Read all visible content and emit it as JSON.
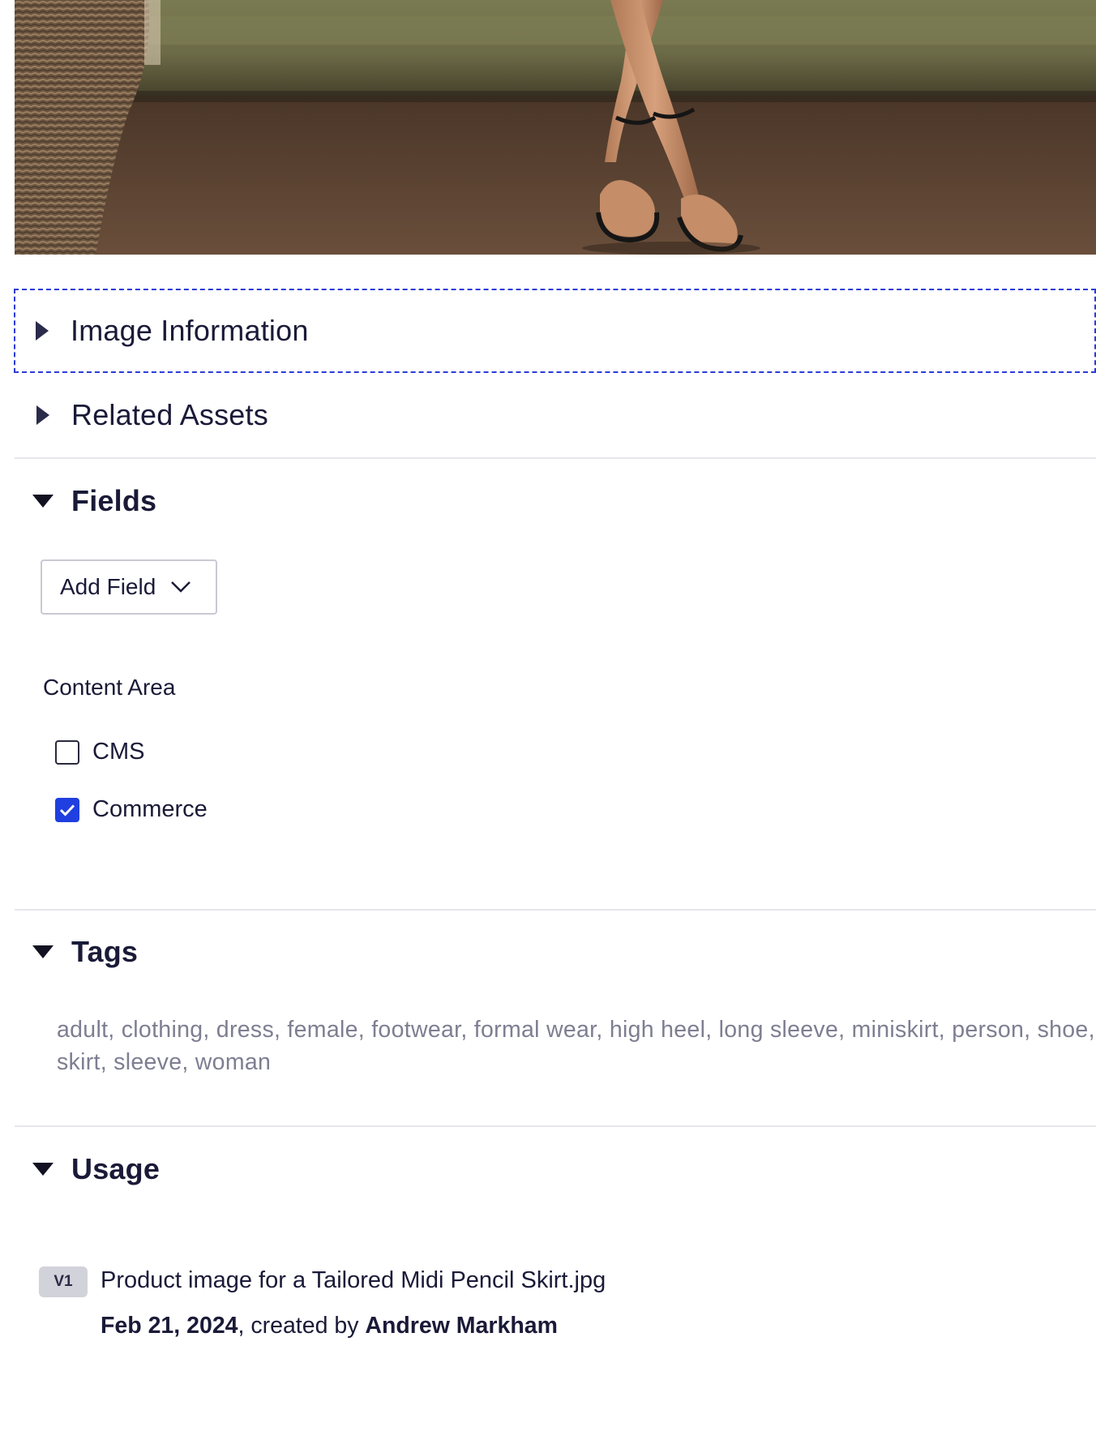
{
  "preview": {
    "alt_icon": "product-photo"
  },
  "sections": {
    "image_information": {
      "title": "Image Information",
      "expanded": false
    },
    "related_assets": {
      "title": "Related Assets",
      "expanded": false
    },
    "fields": {
      "title": "Fields",
      "expanded": true
    },
    "tags": {
      "title": "Tags",
      "expanded": true
    },
    "usage": {
      "title": "Usage",
      "expanded": true
    }
  },
  "fields": {
    "add_field_label": "Add Field",
    "content_area_label": "Content Area",
    "options": [
      {
        "label": "CMS",
        "checked": false
      },
      {
        "label": "Commerce",
        "checked": true
      }
    ]
  },
  "tags": {
    "text": "adult, clothing, dress, female, footwear, formal wear, high heel, long sleeve, miniskirt, person, shoe, skirt, sleeve, woman"
  },
  "usage": {
    "version": "V1",
    "file_name": "Product image for a Tailored Midi Pencil Skirt.jpg",
    "date": "Feb 21, 2024",
    "created_by_text": ", created by ",
    "author": "Andrew Markham"
  },
  "colors": {
    "accent": "#1f3fe0",
    "focus_outline": "#2a3cd8",
    "divider": "#e6e6ec",
    "tag_text": "#7e7e92"
  }
}
